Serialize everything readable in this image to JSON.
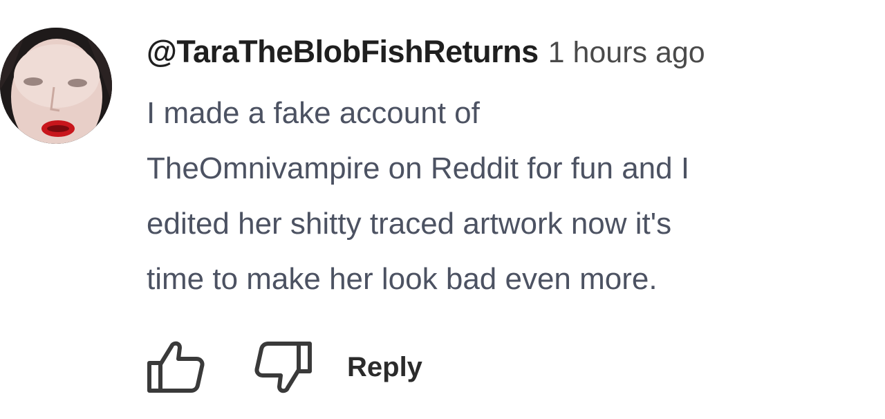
{
  "comment": {
    "author": "@TaraTheBlobFishReturns",
    "timestamp": "1 hours ago",
    "text_lines": [
      "I made a fake account of",
      "TheOmnivampire on Reddit for fun and I",
      "edited her shitty traced artwork now it's",
      "time to make her look bad even more."
    ]
  },
  "actions": {
    "like_icon": "thumbs-up-icon",
    "dislike_icon": "thumbs-down-icon",
    "reply_label": "Reply"
  },
  "colors": {
    "author": "#1f1f1f",
    "body_text": "#4c5262",
    "icon_stroke": "#3a3a3a"
  }
}
